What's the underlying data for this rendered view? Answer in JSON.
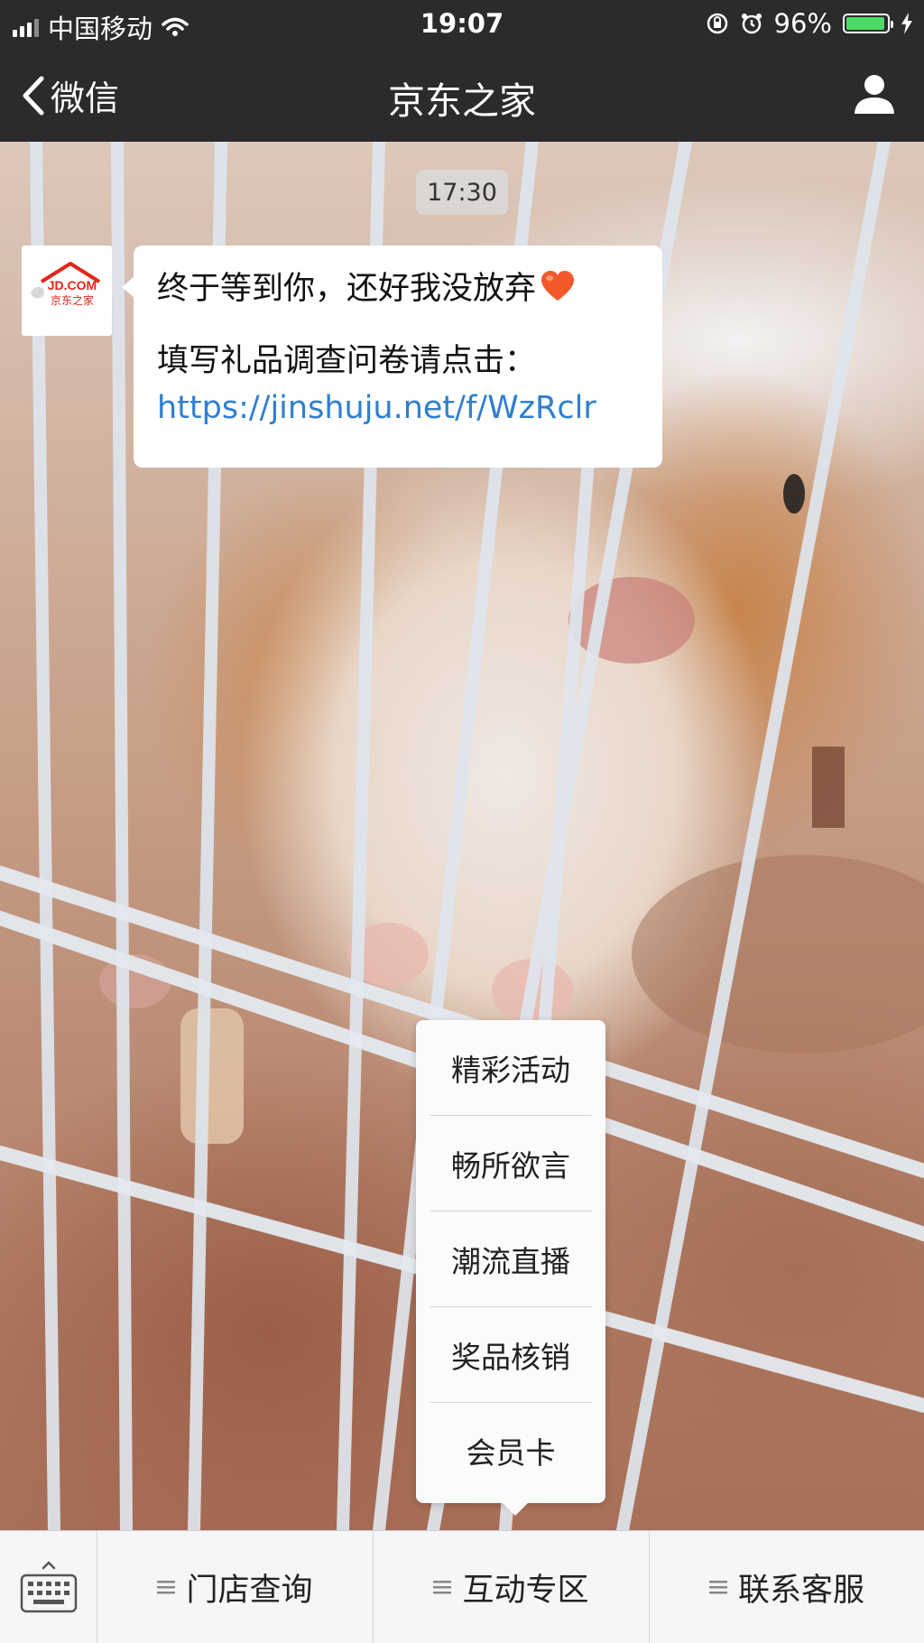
{
  "status_bar": {
    "carrier": "中国移动",
    "time": "19:07",
    "battery_percent": "96%",
    "battery_level": 0.96,
    "icons": [
      "signal-icon",
      "wifi-icon",
      "orientation-lock-icon",
      "alarm-icon",
      "battery-icon",
      "charging-icon"
    ]
  },
  "nav": {
    "back_label": "微信",
    "title": "京东之家",
    "icons": [
      "back-chevron-icon",
      "profile-icon"
    ]
  },
  "chat": {
    "timestamp": "17:30",
    "message": {
      "avatar_logo_text": "JD.COM",
      "avatar_logo_subtext": "京东之家",
      "line1": "终于等到你，还好我没放弃",
      "line2": "填写礼品调查问卷请点击：",
      "link": "https://jinshuju.net/f/WzRclr",
      "emoji": "heart-icon"
    }
  },
  "popup_menu": {
    "items": [
      "精彩活动",
      "畅所欲言",
      "潮流直播",
      "奖品核销",
      "会员卡"
    ]
  },
  "bottom_bar": {
    "keyboard_icon": "keyboard-icon",
    "menus": [
      "门店查询",
      "互动专区",
      "联系客服"
    ]
  },
  "colors": {
    "bar_background": "#2b2b2d",
    "link": "#2f7fd0",
    "battery": "#4cd964"
  }
}
